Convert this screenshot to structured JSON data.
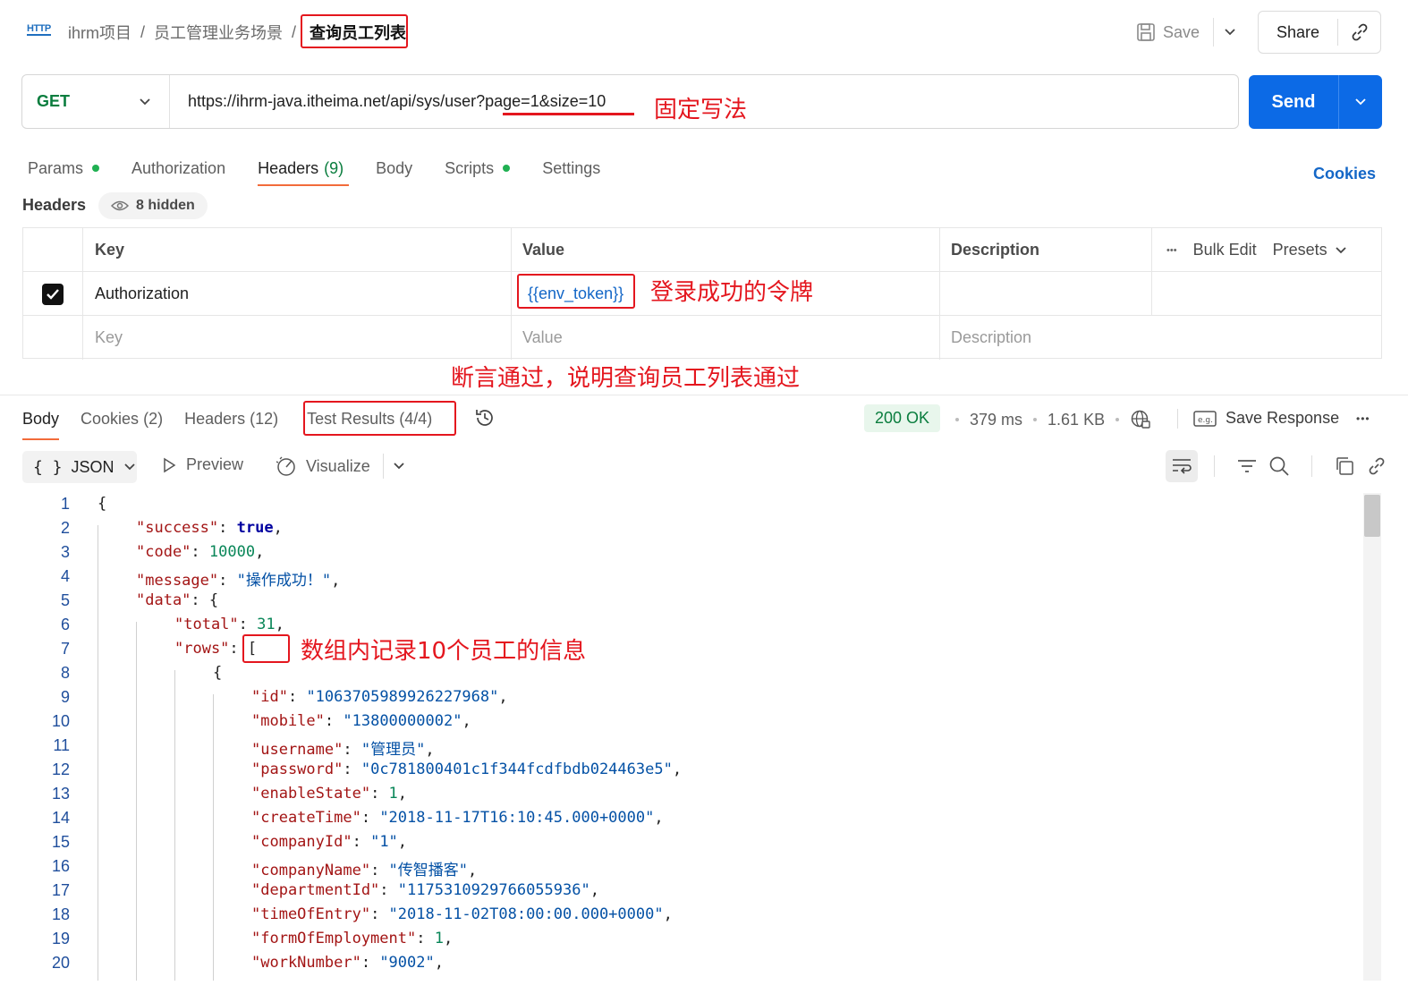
{
  "topbar": {
    "http_badge": "HTTP",
    "breadcrumb": [
      "ihrm项目",
      "员工管理业务场景",
      "查询员工列表"
    ],
    "separator": "/",
    "save_label": "Save",
    "share_label": "Share"
  },
  "request": {
    "method": "GET",
    "url": "https://ihrm-java.itheima.net/api/sys/user?page=1&size=10",
    "send_label": "Send",
    "tabs": [
      {
        "label": "Params",
        "dot": true
      },
      {
        "label": "Authorization"
      },
      {
        "label": "Headers",
        "count": "(9)",
        "active": true
      },
      {
        "label": "Body"
      },
      {
        "label": "Scripts",
        "dot": true
      },
      {
        "label": "Settings"
      }
    ],
    "cookies_label": "Cookies"
  },
  "headers_section": {
    "title": "Headers",
    "hidden_label": "8 hidden",
    "columns": {
      "key": "Key",
      "value": "Value",
      "description": "Description"
    },
    "actions": {
      "more": "•••",
      "bulk_edit": "Bulk Edit",
      "presets": "Presets"
    },
    "rows": [
      {
        "checked": true,
        "key": "Authorization",
        "value": "{{env_token}}",
        "description": ""
      }
    ],
    "placeholders": {
      "key": "Key",
      "value": "Value",
      "description": "Description"
    }
  },
  "annotations": {
    "url": "固定写法",
    "token": "登录成功的令牌",
    "tests": "断言通过，说明查询员工列表通过",
    "rows": "数组内记录10个员工的信息"
  },
  "response": {
    "tabs": [
      {
        "label": "Body",
        "active": true
      },
      {
        "label": "Cookies",
        "count": "(2)"
      },
      {
        "label": "Headers",
        "count": "(12)"
      },
      {
        "label": "Test Results",
        "count": "(4/4)"
      }
    ],
    "status": "200 OK",
    "time": "379 ms",
    "size": "1.61 KB",
    "save_response": "Save Response",
    "more": "•••",
    "format": "JSON",
    "format_icon": "{ }",
    "preview": "Preview",
    "visualize": "Visualize"
  },
  "code_lines": [
    {
      "n": "1",
      "indent": 0,
      "parts": [
        [
          "p",
          "{"
        ]
      ]
    },
    {
      "n": "2",
      "indent": 1,
      "parts": [
        [
          "k",
          "\"success\""
        ],
        [
          "p",
          ": "
        ],
        [
          "b",
          "true"
        ],
        [
          "p",
          ","
        ]
      ]
    },
    {
      "n": "3",
      "indent": 1,
      "parts": [
        [
          "k",
          "\"code\""
        ],
        [
          "p",
          ": "
        ],
        [
          "n",
          "10000"
        ],
        [
          "p",
          ","
        ]
      ]
    },
    {
      "n": "4",
      "indent": 1,
      "parts": [
        [
          "k",
          "\"message\""
        ],
        [
          "p",
          ": "
        ],
        [
          "s",
          "\"操作成功！\""
        ],
        [
          "p",
          ","
        ]
      ]
    },
    {
      "n": "5",
      "indent": 1,
      "parts": [
        [
          "k",
          "\"data\""
        ],
        [
          "p",
          ": {"
        ]
      ]
    },
    {
      "n": "6",
      "indent": 2,
      "parts": [
        [
          "k",
          "\"total\""
        ],
        [
          "p",
          ": "
        ],
        [
          "n",
          "31"
        ],
        [
          "p",
          ","
        ]
      ]
    },
    {
      "n": "7",
      "indent": 2,
      "parts": [
        [
          "k",
          "\"rows\""
        ],
        [
          "p",
          ": ["
        ]
      ]
    },
    {
      "n": "8",
      "indent": 3,
      "parts": [
        [
          "p",
          "{"
        ]
      ]
    },
    {
      "n": "9",
      "indent": 4,
      "parts": [
        [
          "k",
          "\"id\""
        ],
        [
          "p",
          ": "
        ],
        [
          "s",
          "\"1063705989926227968\""
        ],
        [
          "p",
          ","
        ]
      ]
    },
    {
      "n": "10",
      "indent": 4,
      "parts": [
        [
          "k",
          "\"mobile\""
        ],
        [
          "p",
          ": "
        ],
        [
          "s",
          "\"13800000002\""
        ],
        [
          "p",
          ","
        ]
      ]
    },
    {
      "n": "11",
      "indent": 4,
      "parts": [
        [
          "k",
          "\"username\""
        ],
        [
          "p",
          ": "
        ],
        [
          "s",
          "\"管理员\""
        ],
        [
          "p",
          ","
        ]
      ]
    },
    {
      "n": "12",
      "indent": 4,
      "parts": [
        [
          "k",
          "\"password\""
        ],
        [
          "p",
          ": "
        ],
        [
          "s",
          "\"0c781800401c1f344fcdfbdb024463e5\""
        ],
        [
          "p",
          ","
        ]
      ]
    },
    {
      "n": "13",
      "indent": 4,
      "parts": [
        [
          "k",
          "\"enableState\""
        ],
        [
          "p",
          ": "
        ],
        [
          "n",
          "1"
        ],
        [
          "p",
          ","
        ]
      ]
    },
    {
      "n": "14",
      "indent": 4,
      "parts": [
        [
          "k",
          "\"createTime\""
        ],
        [
          "p",
          ": "
        ],
        [
          "s",
          "\"2018-11-17T16:10:45.000+0000\""
        ],
        [
          "p",
          ","
        ]
      ]
    },
    {
      "n": "15",
      "indent": 4,
      "parts": [
        [
          "k",
          "\"companyId\""
        ],
        [
          "p",
          ": "
        ],
        [
          "s",
          "\"1\""
        ],
        [
          "p",
          ","
        ]
      ]
    },
    {
      "n": "16",
      "indent": 4,
      "parts": [
        [
          "k",
          "\"companyName\""
        ],
        [
          "p",
          ": "
        ],
        [
          "s",
          "\"传智播客\""
        ],
        [
          "p",
          ","
        ]
      ]
    },
    {
      "n": "17",
      "indent": 4,
      "parts": [
        [
          "k",
          "\"departmentId\""
        ],
        [
          "p",
          ": "
        ],
        [
          "s",
          "\"1175310929766055936\""
        ],
        [
          "p",
          ","
        ]
      ]
    },
    {
      "n": "18",
      "indent": 4,
      "parts": [
        [
          "k",
          "\"timeOfEntry\""
        ],
        [
          "p",
          ": "
        ],
        [
          "s",
          "\"2018-11-02T08:00:00.000+0000\""
        ],
        [
          "p",
          ","
        ]
      ]
    },
    {
      "n": "19",
      "indent": 4,
      "parts": [
        [
          "k",
          "\"formOfEmployment\""
        ],
        [
          "p",
          ": "
        ],
        [
          "n",
          "1"
        ],
        [
          "p",
          ","
        ]
      ]
    },
    {
      "n": "20",
      "indent": 4,
      "parts": [
        [
          "k",
          "\"workNumber\""
        ],
        [
          "p",
          ": "
        ],
        [
          "s",
          "\"9002\""
        ],
        [
          "p",
          ","
        ]
      ]
    }
  ]
}
